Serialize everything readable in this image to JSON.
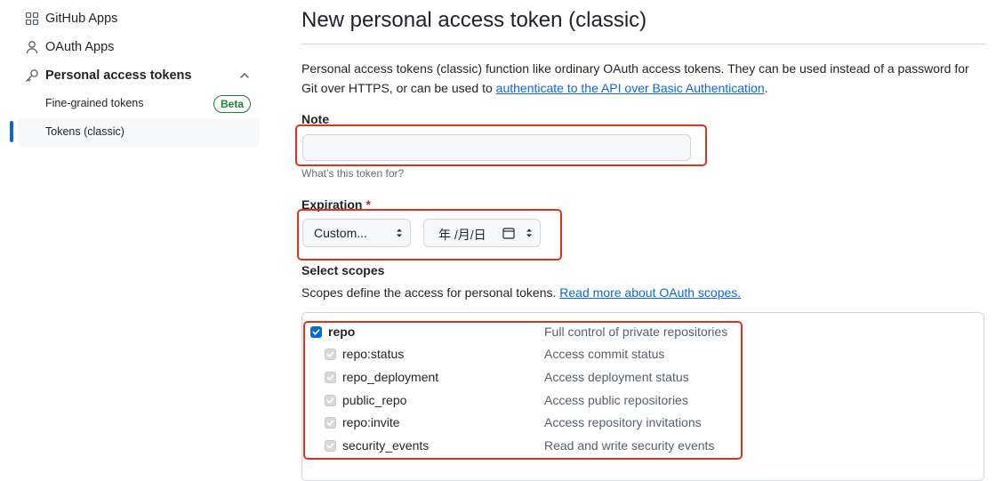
{
  "sidebar": {
    "items": [
      {
        "label": "GitHub Apps",
        "icon": "grid-icon"
      },
      {
        "label": "OAuth Apps",
        "icon": "person-icon"
      },
      {
        "label": "Personal access tokens",
        "icon": "key-icon",
        "expanded": true
      }
    ],
    "sub_items": [
      {
        "label": "Fine-grained tokens",
        "badge": "Beta"
      },
      {
        "label": "Tokens (classic)",
        "active": true
      }
    ]
  },
  "main": {
    "title": "New personal access token (classic)",
    "intro_text": "Personal access tokens (classic) function like ordinary OAuth access tokens. They can be used instead of a password for Git over HTTPS, or can be used to ",
    "intro_link": "authenticate to the API over Basic Authentication",
    "intro_end": ".",
    "note": {
      "label": "Note",
      "value": "",
      "hint": "What’s this token for?"
    },
    "expiration": {
      "label": "Expiration",
      "required_mark": "*",
      "select_value": "Custom...",
      "date_placeholder": "年 /月/日"
    },
    "scopes": {
      "label": "Select scopes",
      "description": "Scopes define the access for personal tokens. ",
      "link": "Read more about OAuth scopes.",
      "rows": [
        {
          "name": "repo",
          "desc": "Full control of private repositories",
          "checked": true,
          "parent": true
        },
        {
          "name": "repo:status",
          "desc": "Access commit status",
          "checked": true
        },
        {
          "name": "repo_deployment",
          "desc": "Access deployment status",
          "checked": true
        },
        {
          "name": "public_repo",
          "desc": "Access public repositories",
          "checked": true
        },
        {
          "name": "repo:invite",
          "desc": "Access repository invitations",
          "checked": true
        },
        {
          "name": "security_events",
          "desc": "Read and write security events",
          "checked": true
        }
      ]
    }
  },
  "colors": {
    "accent": "#0969da",
    "highlight": "#e0301e",
    "success": "#1a7f37",
    "danger": "#cf222e"
  }
}
